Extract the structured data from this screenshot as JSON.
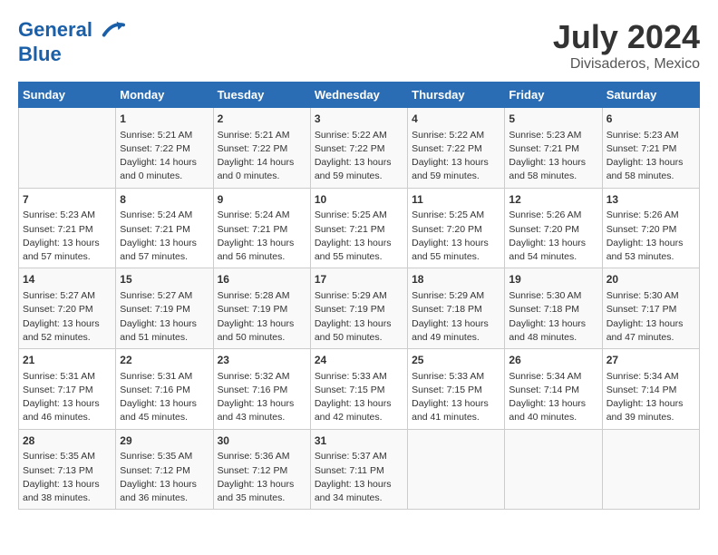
{
  "header": {
    "logo_line1": "General",
    "logo_line2": "Blue",
    "month_year": "July 2024",
    "location": "Divisaderos, Mexico"
  },
  "weekdays": [
    "Sunday",
    "Monday",
    "Tuesday",
    "Wednesday",
    "Thursday",
    "Friday",
    "Saturday"
  ],
  "weeks": [
    [
      {
        "day": "",
        "info": ""
      },
      {
        "day": "1",
        "info": "Sunrise: 5:21 AM\nSunset: 7:22 PM\nDaylight: 14 hours\nand 0 minutes."
      },
      {
        "day": "2",
        "info": "Sunrise: 5:21 AM\nSunset: 7:22 PM\nDaylight: 14 hours\nand 0 minutes."
      },
      {
        "day": "3",
        "info": "Sunrise: 5:22 AM\nSunset: 7:22 PM\nDaylight: 13 hours\nand 59 minutes."
      },
      {
        "day": "4",
        "info": "Sunrise: 5:22 AM\nSunset: 7:22 PM\nDaylight: 13 hours\nand 59 minutes."
      },
      {
        "day": "5",
        "info": "Sunrise: 5:23 AM\nSunset: 7:21 PM\nDaylight: 13 hours\nand 58 minutes."
      },
      {
        "day": "6",
        "info": "Sunrise: 5:23 AM\nSunset: 7:21 PM\nDaylight: 13 hours\nand 58 minutes."
      }
    ],
    [
      {
        "day": "7",
        "info": "Sunrise: 5:23 AM\nSunset: 7:21 PM\nDaylight: 13 hours\nand 57 minutes."
      },
      {
        "day": "8",
        "info": "Sunrise: 5:24 AM\nSunset: 7:21 PM\nDaylight: 13 hours\nand 57 minutes."
      },
      {
        "day": "9",
        "info": "Sunrise: 5:24 AM\nSunset: 7:21 PM\nDaylight: 13 hours\nand 56 minutes."
      },
      {
        "day": "10",
        "info": "Sunrise: 5:25 AM\nSunset: 7:21 PM\nDaylight: 13 hours\nand 55 minutes."
      },
      {
        "day": "11",
        "info": "Sunrise: 5:25 AM\nSunset: 7:20 PM\nDaylight: 13 hours\nand 55 minutes."
      },
      {
        "day": "12",
        "info": "Sunrise: 5:26 AM\nSunset: 7:20 PM\nDaylight: 13 hours\nand 54 minutes."
      },
      {
        "day": "13",
        "info": "Sunrise: 5:26 AM\nSunset: 7:20 PM\nDaylight: 13 hours\nand 53 minutes."
      }
    ],
    [
      {
        "day": "14",
        "info": "Sunrise: 5:27 AM\nSunset: 7:20 PM\nDaylight: 13 hours\nand 52 minutes."
      },
      {
        "day": "15",
        "info": "Sunrise: 5:27 AM\nSunset: 7:19 PM\nDaylight: 13 hours\nand 51 minutes."
      },
      {
        "day": "16",
        "info": "Sunrise: 5:28 AM\nSunset: 7:19 PM\nDaylight: 13 hours\nand 50 minutes."
      },
      {
        "day": "17",
        "info": "Sunrise: 5:29 AM\nSunset: 7:19 PM\nDaylight: 13 hours\nand 50 minutes."
      },
      {
        "day": "18",
        "info": "Sunrise: 5:29 AM\nSunset: 7:18 PM\nDaylight: 13 hours\nand 49 minutes."
      },
      {
        "day": "19",
        "info": "Sunrise: 5:30 AM\nSunset: 7:18 PM\nDaylight: 13 hours\nand 48 minutes."
      },
      {
        "day": "20",
        "info": "Sunrise: 5:30 AM\nSunset: 7:17 PM\nDaylight: 13 hours\nand 47 minutes."
      }
    ],
    [
      {
        "day": "21",
        "info": "Sunrise: 5:31 AM\nSunset: 7:17 PM\nDaylight: 13 hours\nand 46 minutes."
      },
      {
        "day": "22",
        "info": "Sunrise: 5:31 AM\nSunset: 7:16 PM\nDaylight: 13 hours\nand 45 minutes."
      },
      {
        "day": "23",
        "info": "Sunrise: 5:32 AM\nSunset: 7:16 PM\nDaylight: 13 hours\nand 43 minutes."
      },
      {
        "day": "24",
        "info": "Sunrise: 5:33 AM\nSunset: 7:15 PM\nDaylight: 13 hours\nand 42 minutes."
      },
      {
        "day": "25",
        "info": "Sunrise: 5:33 AM\nSunset: 7:15 PM\nDaylight: 13 hours\nand 41 minutes."
      },
      {
        "day": "26",
        "info": "Sunrise: 5:34 AM\nSunset: 7:14 PM\nDaylight: 13 hours\nand 40 minutes."
      },
      {
        "day": "27",
        "info": "Sunrise: 5:34 AM\nSunset: 7:14 PM\nDaylight: 13 hours\nand 39 minutes."
      }
    ],
    [
      {
        "day": "28",
        "info": "Sunrise: 5:35 AM\nSunset: 7:13 PM\nDaylight: 13 hours\nand 38 minutes."
      },
      {
        "day": "29",
        "info": "Sunrise: 5:35 AM\nSunset: 7:12 PM\nDaylight: 13 hours\nand 36 minutes."
      },
      {
        "day": "30",
        "info": "Sunrise: 5:36 AM\nSunset: 7:12 PM\nDaylight: 13 hours\nand 35 minutes."
      },
      {
        "day": "31",
        "info": "Sunrise: 5:37 AM\nSunset: 7:11 PM\nDaylight: 13 hours\nand 34 minutes."
      },
      {
        "day": "",
        "info": ""
      },
      {
        "day": "",
        "info": ""
      },
      {
        "day": "",
        "info": ""
      }
    ]
  ]
}
